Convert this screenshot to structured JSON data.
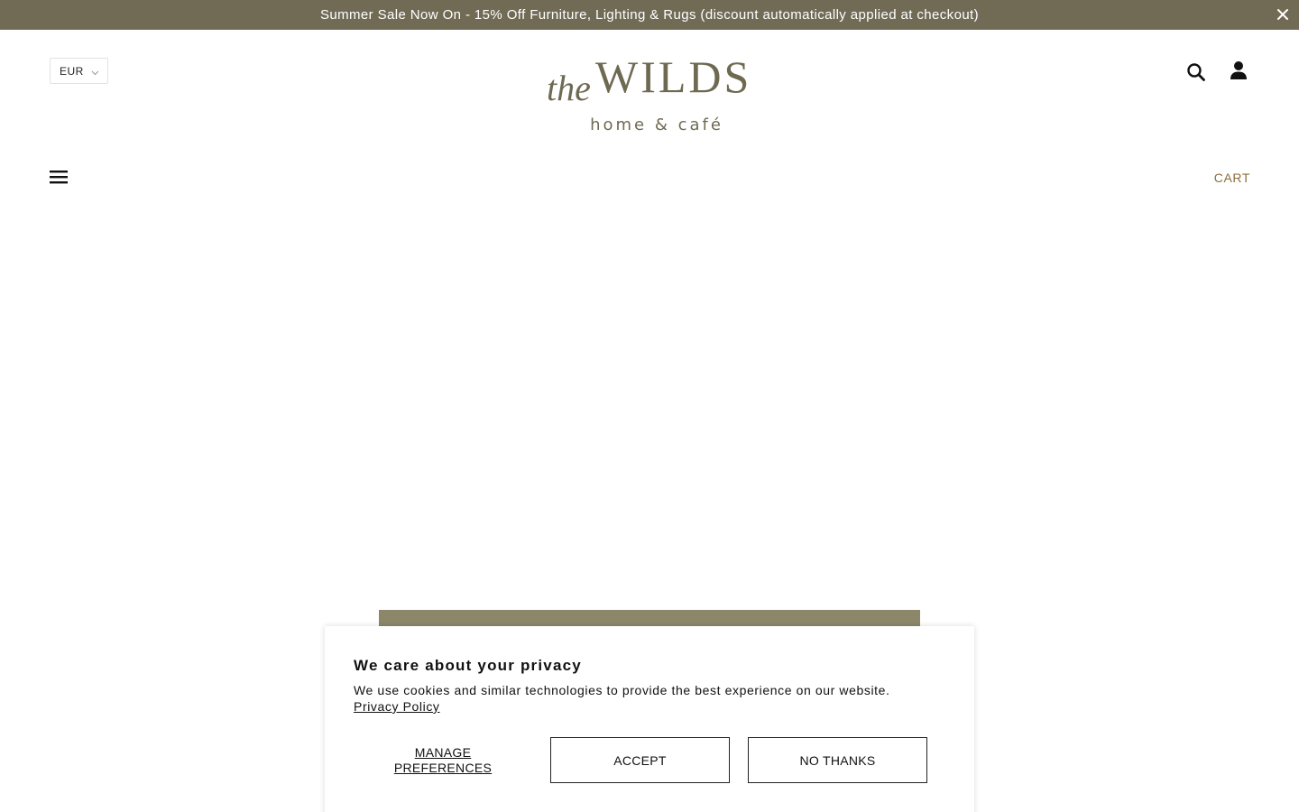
{
  "announcement": {
    "text": "Summer Sale Now On - 15% Off Furniture, Lighting & Rugs (discount automatically applied at checkout)",
    "close_icon": "close-icon"
  },
  "header": {
    "currency": "EUR",
    "logo": {
      "prefix": "the",
      "name": "WILDS",
      "tagline": "home & café"
    },
    "icons": [
      "search-icon",
      "account-icon",
      "menu-icon"
    ],
    "cart_label": "CART"
  },
  "cookie_banner": {
    "title": "We care about your privacy",
    "text": "We use cookies and similar technologies to provide the best experience on our website.",
    "policy_link": "Privacy Policy",
    "manage_label_1": "MANAGE",
    "manage_label_2": "PREFERENCES",
    "accept_label": "ACCEPT",
    "decline_label": "NO THANKS"
  },
  "colors": {
    "announcement_bg": "#716b56",
    "brand": "#6e6a52",
    "cart": "#8a6d3e",
    "hero_strip": "#8c8769"
  }
}
